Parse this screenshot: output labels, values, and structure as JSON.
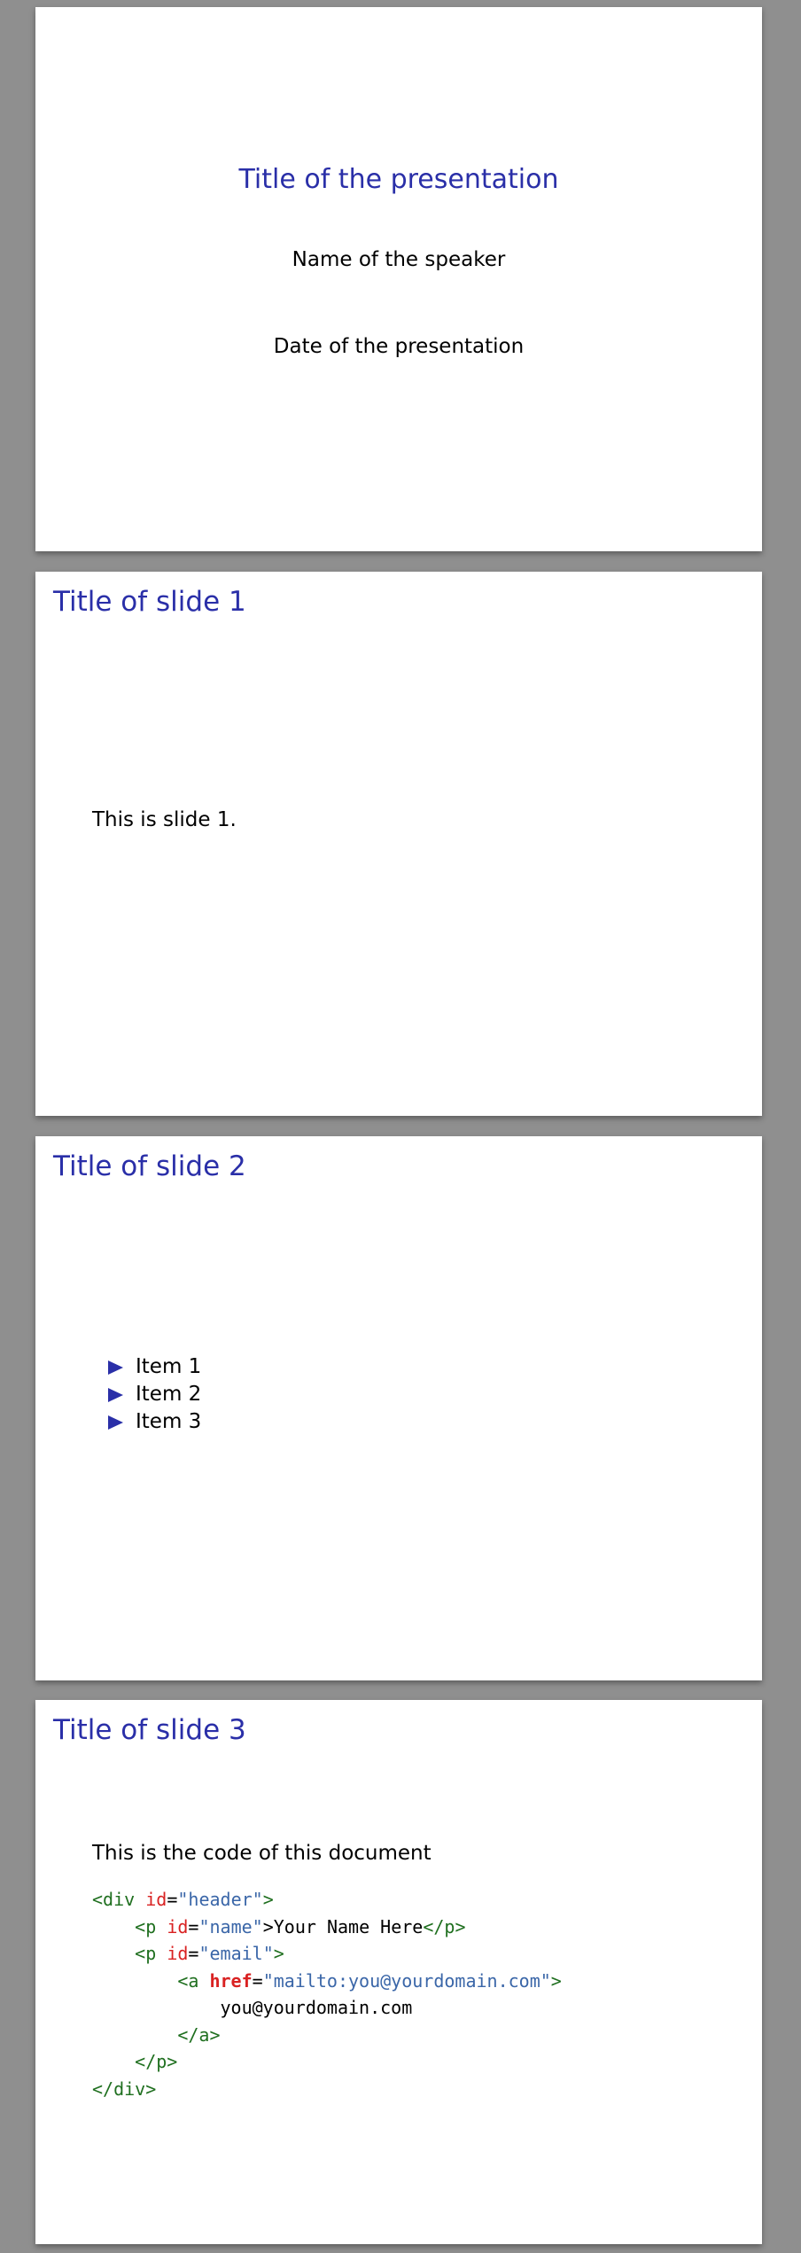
{
  "title_slide": {
    "title": "Title of the presentation",
    "speaker": "Name of the speaker",
    "date": "Date of the presentation"
  },
  "slide1": {
    "title": "Title of slide 1",
    "text": "This is slide 1."
  },
  "slide2": {
    "title": "Title of slide 2",
    "items": [
      "Item 1",
      "Item 2",
      "Item 3"
    ]
  },
  "slide3": {
    "title": "Title of slide 3",
    "intro": "This is the code of this document",
    "code": {
      "div_open_tag": "<div",
      "div_id_attr": "id",
      "div_id_value": "\"header\"",
      "div_open_close": ">",
      "p1_open_tag": "<p",
      "p1_id_attr": "id",
      "p1_id_value": "\"name\"",
      "p1_text": ">Your Name Here",
      "p1_close_tag": "</p>",
      "p2_open_tag": "<p",
      "p2_id_attr": "id",
      "p2_id_value": "\"email\"",
      "p2_open_close": ">",
      "a_open_tag": "<a",
      "a_href_attr": "href",
      "a_href_value": "\"mailto:you@yourdomain.com\"",
      "a_open_close": ">",
      "a_text": "you@yourdomain.com",
      "a_close_tag": "</a>",
      "p2_close_tag": "</p>",
      "div_close_tag": "</div>"
    },
    "colors": {
      "tag": "#1f6f1f",
      "attribute": "#d92222",
      "string": "#3a66a8"
    }
  },
  "accent_color": "#2a2fa8"
}
